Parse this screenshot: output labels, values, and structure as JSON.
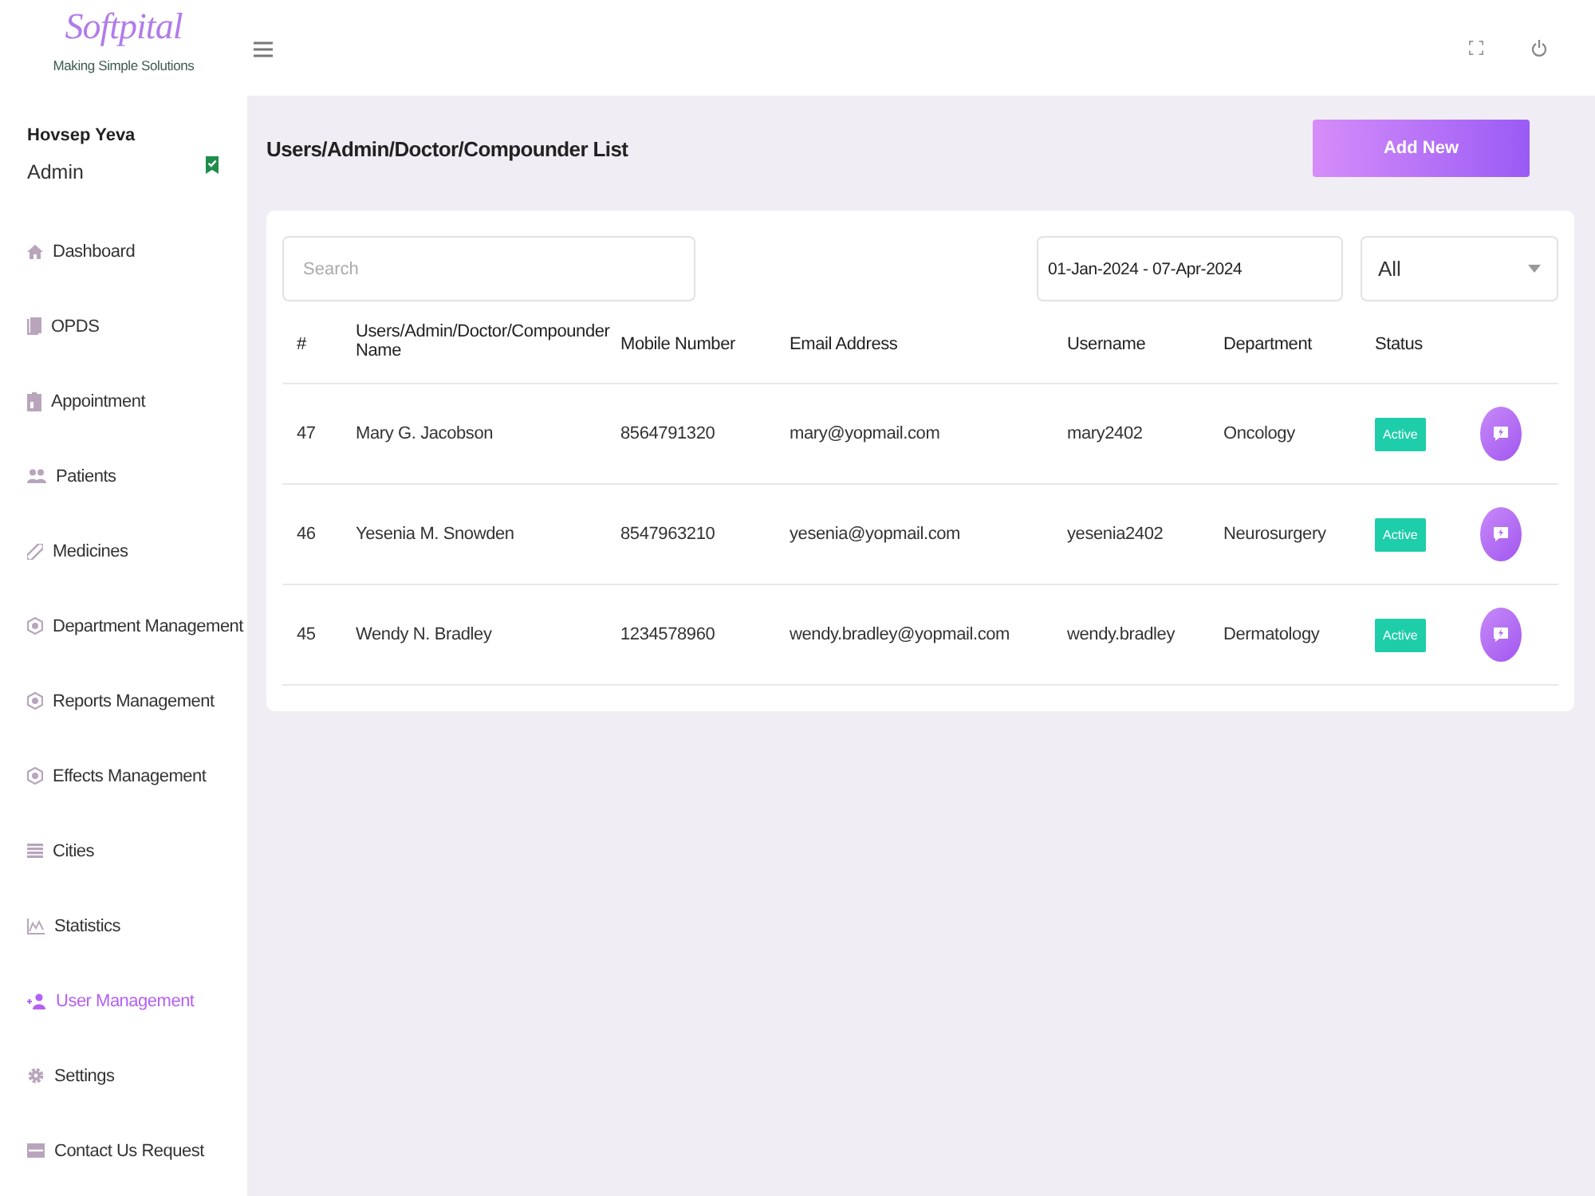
{
  "brand": {
    "logo": "Softpital",
    "tagline": "Making Simple Solutions"
  },
  "user": {
    "name": "Hovsep Yeva",
    "role": "Admin"
  },
  "sidebar": {
    "items": [
      {
        "label": "Dashboard",
        "selected": false
      },
      {
        "label": "OPDS",
        "selected": false
      },
      {
        "label": "Appointment",
        "selected": false
      },
      {
        "label": "Patients",
        "selected": false
      },
      {
        "label": "Medicines",
        "selected": false
      },
      {
        "label": "Department Management",
        "selected": false
      },
      {
        "label": "Reports Management",
        "selected": false
      },
      {
        "label": "Effects Management",
        "selected": false
      },
      {
        "label": "Cities",
        "selected": false
      },
      {
        "label": "Statistics",
        "selected": false
      },
      {
        "label": "User Management",
        "selected": true
      },
      {
        "label": "Settings",
        "selected": false
      },
      {
        "label": "Contact Us Request",
        "selected": false
      }
    ]
  },
  "page": {
    "title": "Users/Admin/Doctor/Compounder List",
    "add_button": "Add New"
  },
  "filters": {
    "search": {
      "placeholder": "Search"
    },
    "date_range": {
      "value": "01-Jan-2024 - 07-Apr-2024"
    },
    "status_select": {
      "value": "All"
    }
  },
  "table": {
    "columns": [
      "#",
      "Users/Admin/Doctor/Compounder Name",
      "Mobile Number",
      "Email Address",
      "Username",
      "Department",
      "Status"
    ],
    "rows": [
      {
        "id": "47",
        "name": "Mary G. Jacobson",
        "mobile": "8564791320",
        "email": "mary@yopmail.com",
        "username": "mary2402",
        "department": "Oncology",
        "status": "Active"
      },
      {
        "id": "46",
        "name": "Yesenia M. Snowden",
        "mobile": "8547963210",
        "email": "yesenia@yopmail.com",
        "username": "yesenia2402",
        "department": "Neurosurgery",
        "status": "Active"
      },
      {
        "id": "45",
        "name": "Wendy N. Bradley",
        "mobile": "1234578960",
        "email": "wendy.bradley@yopmail.com",
        "username": "wendy.bradley",
        "department": "Dermatology",
        "status": "Active"
      }
    ]
  }
}
